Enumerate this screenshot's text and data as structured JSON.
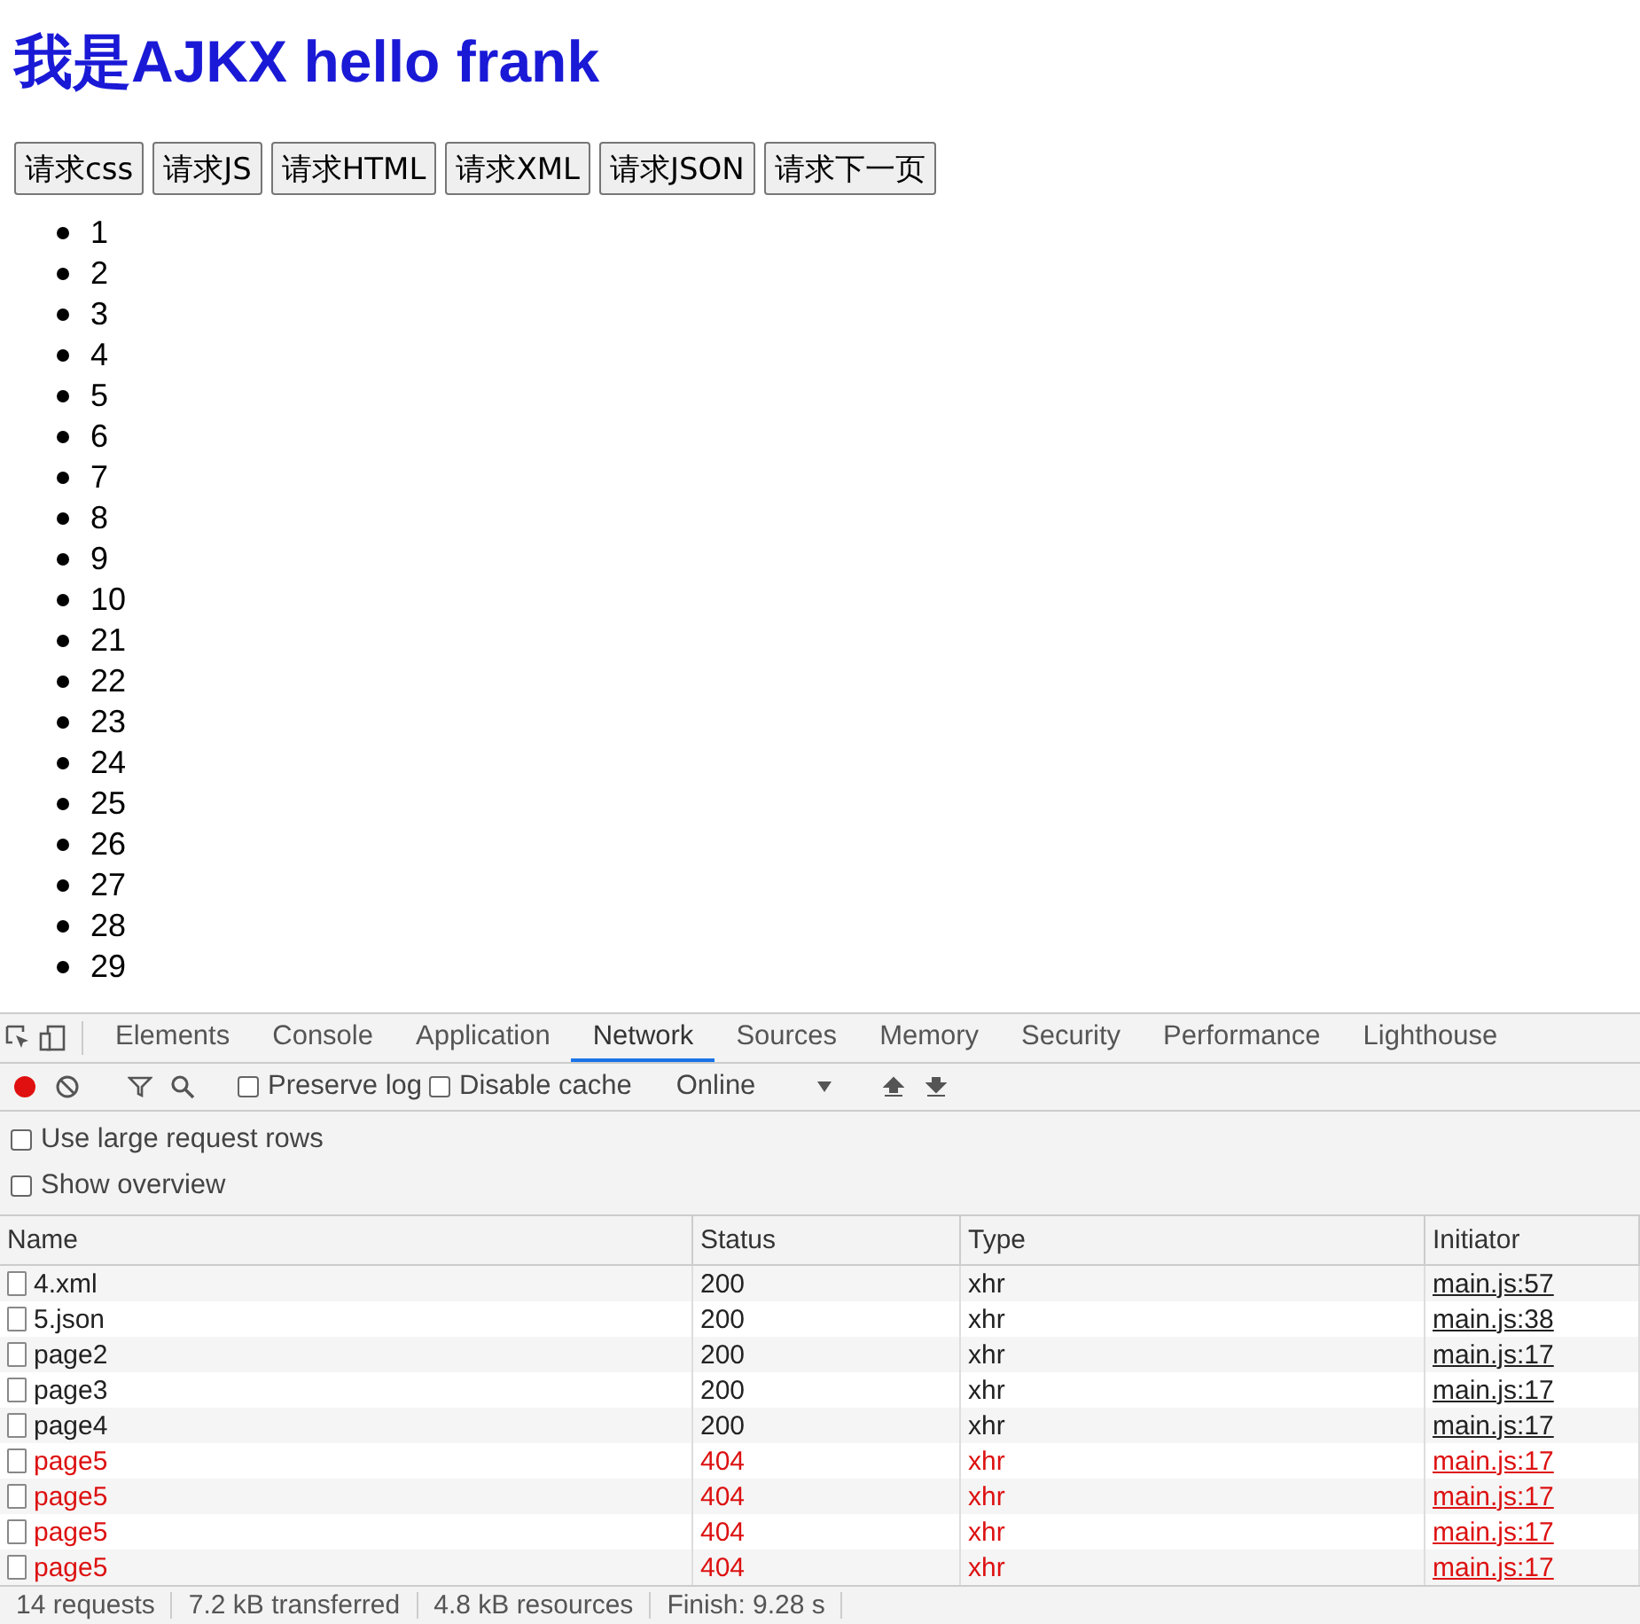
{
  "page": {
    "heading": "我是AJKX hello frank",
    "buttons": [
      "请求css",
      "请求JS",
      "请求HTML",
      "请求XML",
      "请求JSON",
      "请求下一页"
    ],
    "list": [
      "1",
      "2",
      "3",
      "4",
      "5",
      "6",
      "7",
      "8",
      "9",
      "10",
      "21",
      "22",
      "23",
      "24",
      "25",
      "26",
      "27",
      "28",
      "29"
    ]
  },
  "devtools": {
    "tabs": [
      {
        "label": "Elements",
        "selected": false
      },
      {
        "label": "Console",
        "selected": false
      },
      {
        "label": "Application",
        "selected": false
      },
      {
        "label": "Network",
        "selected": true
      },
      {
        "label": "Sources",
        "selected": false
      },
      {
        "label": "Memory",
        "selected": false
      },
      {
        "label": "Security",
        "selected": false
      },
      {
        "label": "Performance",
        "selected": false
      },
      {
        "label": "Lighthouse",
        "selected": false
      }
    ],
    "toolbar": {
      "recording": true,
      "preserve_log": {
        "label": "Preserve log",
        "checked": false
      },
      "disable_cache": {
        "label": "Disable cache",
        "checked": false
      },
      "throttling": "Online"
    },
    "options": [
      {
        "label": "Use large request rows",
        "checked": false
      },
      {
        "label": "Show overview",
        "checked": false
      }
    ],
    "table": {
      "columns": [
        "Name",
        "Status",
        "Type",
        "Initiator"
      ],
      "rows": [
        {
          "name": "4.xml",
          "status": "200",
          "type": "xhr",
          "initiator": "main.js:57",
          "failed": false
        },
        {
          "name": "5.json",
          "status": "200",
          "type": "xhr",
          "initiator": "main.js:38",
          "failed": false
        },
        {
          "name": "page2",
          "status": "200",
          "type": "xhr",
          "initiator": "main.js:17",
          "failed": false
        },
        {
          "name": "page3",
          "status": "200",
          "type": "xhr",
          "initiator": "main.js:17",
          "failed": false
        },
        {
          "name": "page4",
          "status": "200",
          "type": "xhr",
          "initiator": "main.js:17",
          "failed": false
        },
        {
          "name": "page5",
          "status": "404",
          "type": "xhr",
          "initiator": "main.js:17",
          "failed": true
        },
        {
          "name": "page5",
          "status": "404",
          "type": "xhr",
          "initiator": "main.js:17",
          "failed": true
        },
        {
          "name": "page5",
          "status": "404",
          "type": "xhr",
          "initiator": "main.js:17",
          "failed": true
        },
        {
          "name": "page5",
          "status": "404",
          "type": "xhr",
          "initiator": "main.js:17",
          "failed": true
        }
      ]
    },
    "status_bar": [
      "14 requests",
      "7.2 kB transferred",
      "4.8 kB resources",
      "Finish: 9.28 s"
    ]
  }
}
